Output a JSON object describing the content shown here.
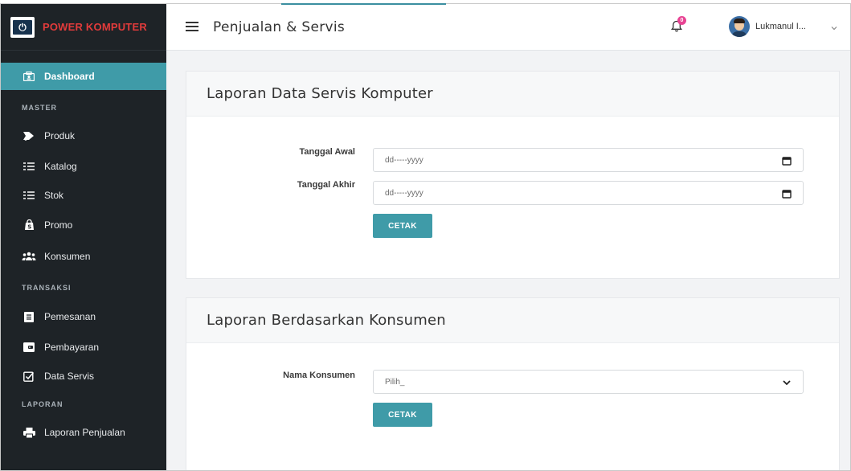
{
  "brand": {
    "name": "POWER KOMPUTER",
    "logo_glyph": "⏻"
  },
  "sidebar": {
    "dashboard": "Dashboard",
    "heading_master": "MASTER",
    "produk": "Produk",
    "katalog": "Katalog",
    "stok": "Stok",
    "promo": "Promo",
    "konsumen": "Konsumen",
    "heading_transaksi": "TRANSAKSI",
    "pemesanan": "Pemesanan",
    "pembayaran": "Pembayaran",
    "data_servis": "Data Servis",
    "heading_laporan": "LAPORAN",
    "laporan_penjualan": "Laporan Penjualan"
  },
  "topbar": {
    "title": "Penjualan & Servis",
    "notif_count": "0",
    "user_name": "Lukmanul I..."
  },
  "card1": {
    "title": "Laporan Data Servis Komputer",
    "label_start": "Tanggal Awal",
    "label_end": "Tanggal Akhir",
    "start_value": "dd-----yyyy",
    "end_value": "dd-----yyyy",
    "button": "CETAK"
  },
  "card2": {
    "title": "Laporan Berdasarkan Konsumen",
    "label_customer": "Nama Konsumen",
    "select_value": "Pilih_",
    "button": "CETAK"
  },
  "colors": {
    "accent": "#3f9ba8",
    "sidebar_bg": "#1e2327",
    "brand_red": "#e23b3b",
    "badge": "#e84393"
  }
}
